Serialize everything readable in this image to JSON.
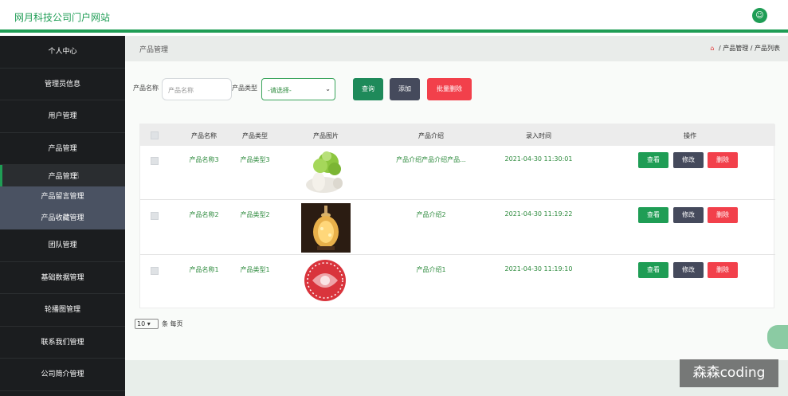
{
  "app": {
    "title": "网月科技公司门户网站"
  },
  "sidebar": {
    "items": [
      {
        "label": "个人中心"
      },
      {
        "label": "管理员信息"
      },
      {
        "label": "用户管理"
      },
      {
        "label": "产品管理"
      },
      {
        "label": "产品管理",
        "sub": true,
        "active": true
      },
      {
        "label": "产品留言管理",
        "sub": true
      },
      {
        "label": "产品收藏管理",
        "sub": true
      },
      {
        "label": "团队管理"
      },
      {
        "label": "基础数据管理"
      },
      {
        "label": "轮播图管理"
      },
      {
        "label": "联系我们管理"
      },
      {
        "label": "公司简介管理"
      }
    ]
  },
  "header": {
    "page_title": "产品管理",
    "breadcrumb": [
      "产品管理",
      "产品列表"
    ],
    "separator": "/"
  },
  "filters": {
    "name_label": "产品名称",
    "name_placeholder": "产品名称",
    "type_label": "产品类型",
    "type_selected": "-请选择-",
    "query_label": "查询",
    "add_label": "添加",
    "batch_delete_label": "批量删除"
  },
  "table": {
    "columns": [
      "产品名称",
      "产品类型",
      "产品图片",
      "产品介绍",
      "录入时间",
      "操作"
    ],
    "rows": [
      {
        "name": "产品名称3",
        "type": "产品类型3",
        "intro": "产品介绍产品介绍产品...",
        "time": "2021-04-30 11:30:01",
        "image": "cabbage-sculpture"
      },
      {
        "name": "产品名称2",
        "type": "产品类型2",
        "intro": "产品介绍2",
        "time": "2021-04-30 11:19:22",
        "image": "glowing-vase"
      },
      {
        "name": "产品名称1",
        "type": "产品类型1",
        "intro": "产品介绍1",
        "time": "2021-04-30 11:19:10",
        "image": "red-papercut"
      }
    ],
    "actions": {
      "view": "查看",
      "edit": "修改",
      "delete": "删除"
    }
  },
  "pager": {
    "page_size": "10",
    "per_page_label": "条 每页"
  },
  "watermark": {
    "text": "森森coding"
  },
  "colors": {
    "brand": "#1f9d55",
    "sidebar": "#1b1d1f",
    "danger": "#f2404b",
    "dark": "#454a5c",
    "view_btn": "#1f9d55"
  }
}
